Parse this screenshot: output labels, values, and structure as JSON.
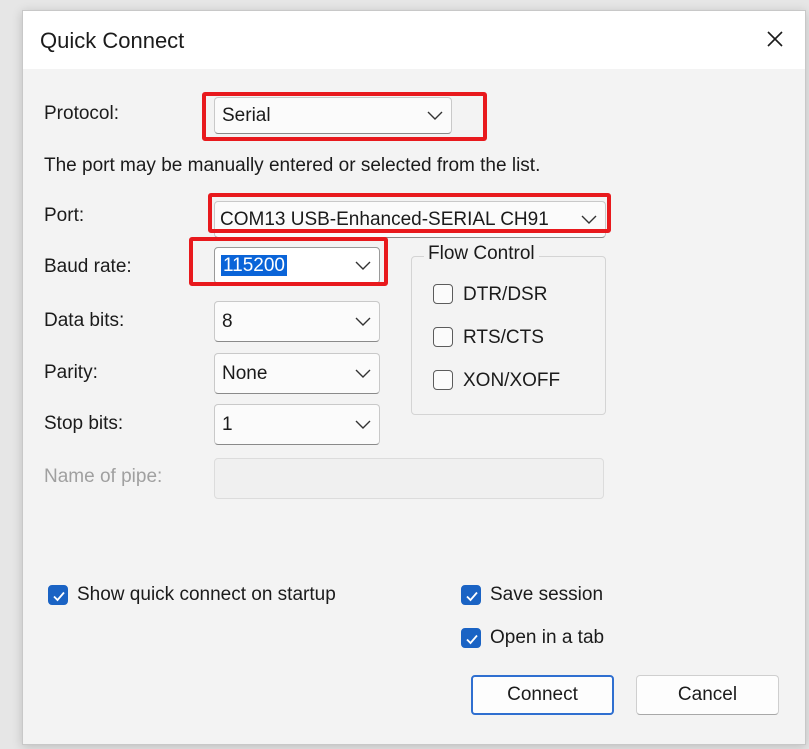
{
  "dialog": {
    "title": "Quick Connect",
    "close_symbol": "✕"
  },
  "protocol": {
    "label": "Protocol:",
    "value": "Serial"
  },
  "port_hint": "The port may be manually entered or selected from the list.",
  "port": {
    "label": "Port:",
    "value": "COM13 USB-Enhanced-SERIAL CH91"
  },
  "baud_rate": {
    "label": "Baud rate:",
    "value": "115200"
  },
  "data_bits": {
    "label": "Data bits:",
    "value": "8"
  },
  "parity": {
    "label": "Parity:",
    "value": "None"
  },
  "stop_bits": {
    "label": "Stop bits:",
    "value": "1"
  },
  "flow_control": {
    "title": "Flow Control",
    "options": [
      {
        "label": "DTR/DSR",
        "checked": false
      },
      {
        "label": "RTS/CTS",
        "checked": false
      },
      {
        "label": "XON/XOFF",
        "checked": false
      }
    ]
  },
  "pipe": {
    "label": "Name of pipe:",
    "value": ""
  },
  "options": {
    "show_on_startup": {
      "label": "Show quick connect on startup",
      "checked": true
    },
    "save_session": {
      "label": "Save session",
      "checked": true
    },
    "open_in_tab": {
      "label": "Open in a tab",
      "checked": true
    }
  },
  "buttons": {
    "connect": "Connect",
    "cancel": "Cancel"
  },
  "colors": {
    "highlight": "#e8191d",
    "accent": "#1a63c4",
    "selection": "#0a64d8"
  },
  "icons": {
    "close": "close-icon",
    "dropdown": "chevron-down-icon",
    "check": "checkmark-icon"
  }
}
